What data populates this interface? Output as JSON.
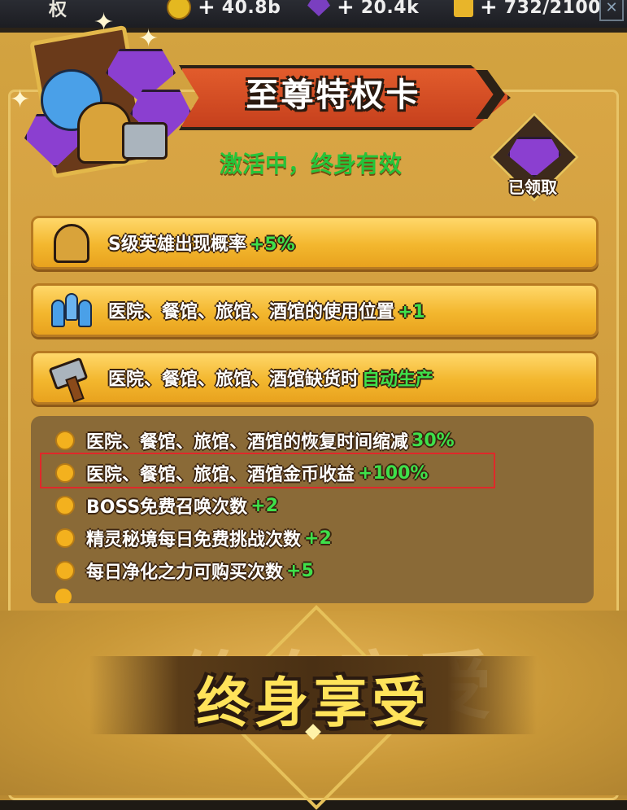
{
  "topbar": {
    "left_label": "权",
    "resources": [
      {
        "icon": "coin-icon",
        "value": "40.8b"
      },
      {
        "icon": "purple-gem-icon",
        "value": "20.4k"
      },
      {
        "icon": "hammer-icon",
        "value": "732/2100"
      }
    ]
  },
  "card": {
    "title": "至尊特权卡",
    "status": "激活中，终身有效",
    "claimed_label": "已领取"
  },
  "benefits": [
    {
      "icon": "helmet-icon",
      "text": "S级英雄出现概率",
      "highlight": "+5%"
    },
    {
      "icon": "people-icon",
      "text": "医院、餐馆、旅馆、酒馆的使用位置",
      "highlight": "+1"
    },
    {
      "icon": "hammer-icon",
      "text": "医院、餐馆、旅馆、酒馆缺货时",
      "highlight": "自动生产"
    }
  ],
  "list": [
    {
      "text": "医院、餐馆、旅馆、酒馆的恢复时间缩减",
      "highlight": "30%"
    },
    {
      "text": "医院、餐馆、旅馆、酒馆金币收益",
      "highlight": "+100%"
    },
    {
      "text": "BOSS免费召唤次数",
      "highlight": "+2"
    },
    {
      "text": "精灵秘境每日免费挑战次数",
      "highlight": "+2"
    },
    {
      "text": "每日净化之力可购买次数",
      "highlight": "+5"
    }
  ],
  "footer": {
    "title": "终身享受",
    "ghost": "终身享受"
  },
  "colors": {
    "highlight_green": "#3ee04a",
    "status_green": "#26c43a",
    "banner_red": "#d84e25",
    "selection_red": "#e0282a"
  }
}
